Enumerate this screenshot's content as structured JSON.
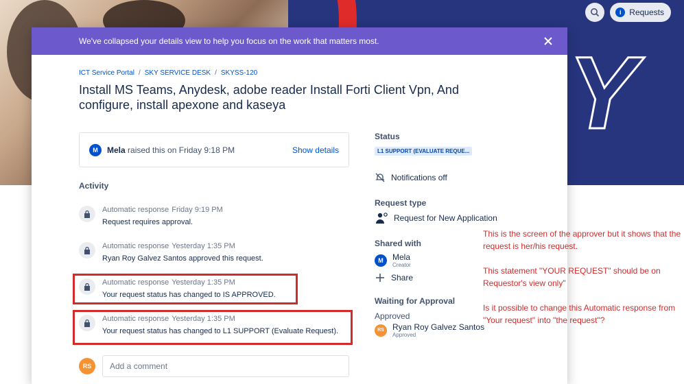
{
  "top": {
    "requests_label": "Requests"
  },
  "hero": {
    "letter": "Y"
  },
  "banner": {
    "text": "We've collapsed your details view to help you focus on the work that matters most."
  },
  "breadcrumb": [
    "ICT Service Portal",
    "SKY SERVICE DESK",
    "SKYSS-120"
  ],
  "title": "Install MS Teams, Anydesk, adobe reader  Install Forti Client Vpn, And configure, install apexone and kaseya",
  "raised": {
    "avatar": "M",
    "name": "Mela",
    "text": "raised this on Friday 9:18 PM",
    "show_details": "Show details"
  },
  "activity": {
    "label": "Activity",
    "items": [
      {
        "author": "Automatic response",
        "time": "Friday 9:19 PM",
        "message": "Request requires approval."
      },
      {
        "author": "Automatic response",
        "time": "Yesterday 1:35 PM",
        "message": "Ryan Roy Galvez Santos approved this request."
      },
      {
        "author": "Automatic response",
        "time": "Yesterday 1:35 PM",
        "message": "Your request status has changed to IS APPROVED."
      },
      {
        "author": "Automatic response",
        "time": "Yesterday 1:35 PM",
        "message": "Your request status has changed to L1 SUPPORT (Evaluate Request)."
      }
    ]
  },
  "comment": {
    "avatar": "RS",
    "placeholder": "Add a comment"
  },
  "sidebar": {
    "status_label": "Status",
    "status_value": "L1 SUPPORT (EVALUATE REQUE...",
    "notifications": "Notifications off",
    "request_type_label": "Request type",
    "request_type": "Request for New Application",
    "shared_label": "Shared with",
    "shared_user": {
      "avatar": "M",
      "name": "Mela",
      "role": "Creator"
    },
    "share": "Share",
    "waiting_label": "Waiting for Approval",
    "approved_label": "Approved",
    "approver": {
      "avatar": "RS",
      "name": "Ryan Roy Galvez Santos",
      "role": "Approved"
    }
  },
  "note": {
    "p1": "This is the screen of the approver but it shows that the request is her/his request.",
    "p2": "This statement \"YOUR REQUEST\" should be on Requestor's view only\"",
    "p3": "Is it possible to change this Automatic response from \"Your request\" into \"the request\"?"
  },
  "colors": {
    "banner": "#6c5acd",
    "highlight": "#d12b2b",
    "link": "#0052cc"
  }
}
